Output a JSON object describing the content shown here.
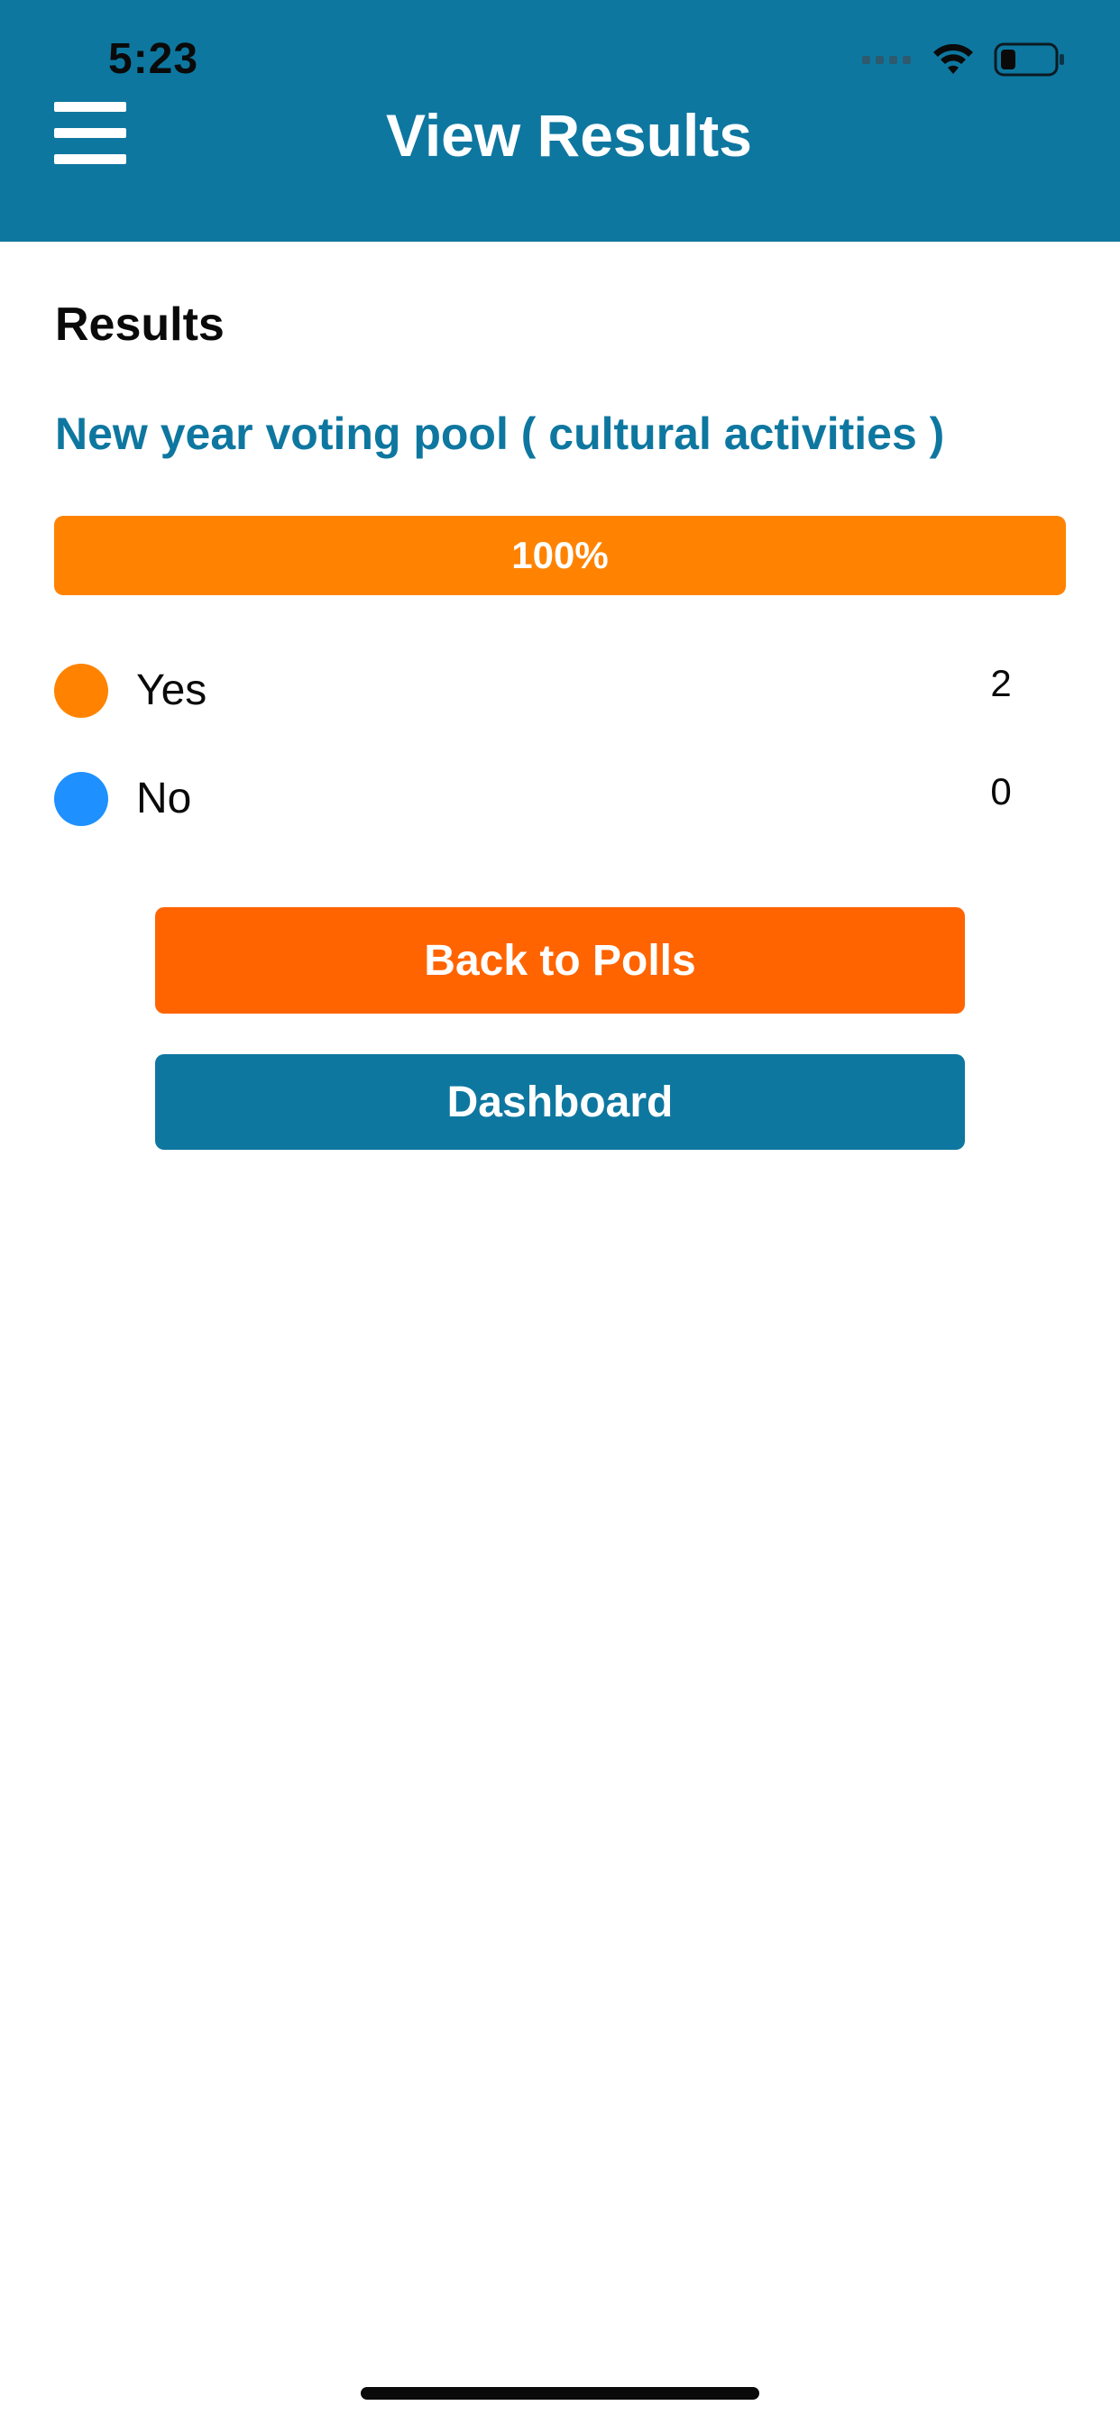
{
  "status_bar": {
    "time": "5:23"
  },
  "header": {
    "title": "View Results"
  },
  "content": {
    "section_title": "Results",
    "poll_question": "New year voting pool ( cultural activities )",
    "progress": {
      "label": "100%",
      "value_percent": 100,
      "color": "#ff8300"
    },
    "options": [
      {
        "label": "Yes",
        "count": "2",
        "color": "#ff8300"
      },
      {
        "label": "No",
        "count": "0",
        "color": "#1e90ff"
      }
    ]
  },
  "buttons": {
    "back_label": "Back to Polls",
    "dashboard_label": "Dashboard"
  },
  "colors": {
    "header_bg": "#0e77a0",
    "accent_orange": "#ff6400",
    "link_blue": "#0e77a0"
  }
}
